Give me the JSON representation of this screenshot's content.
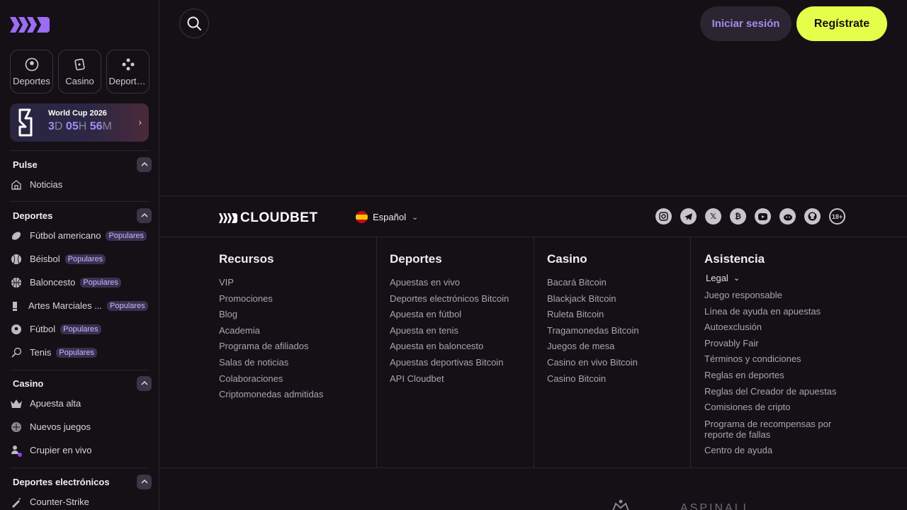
{
  "sidebar": {
    "quick_tiles": [
      {
        "label": "Deportes",
        "icon": "soccer-ball-icon"
      },
      {
        "label": "Casino",
        "icon": "cards-icon"
      },
      {
        "label": "Deportes electrónicos",
        "icon": "gamepad-icon"
      }
    ],
    "promo": {
      "title": "World Cup 2026",
      "days": "3",
      "days_unit": "D",
      "hours": "05",
      "hours_unit": "H",
      "minutes": "56",
      "minutes_unit": "M"
    },
    "sections": [
      {
        "title": "Pulse",
        "items": [
          {
            "label": "Noticias",
            "icon": "home-icon"
          }
        ]
      },
      {
        "title": "Deportes",
        "items": [
          {
            "label": "Fútbol americano",
            "badge": "Populares",
            "icon": "american-football-icon"
          },
          {
            "label": "Béisbol",
            "badge": "Populares",
            "icon": "baseball-icon"
          },
          {
            "label": "Baloncesto",
            "badge": "Populares",
            "icon": "basketball-icon"
          },
          {
            "label": "Artes Marciales ...",
            "badge": "Populares",
            "icon": "glove-icon"
          },
          {
            "label": "Fútbol",
            "badge": "Populares",
            "icon": "soccer-ball-icon"
          },
          {
            "label": "Tenis",
            "badge": "Populares",
            "icon": "tennis-racket-icon"
          }
        ]
      },
      {
        "title": "Casino",
        "items": [
          {
            "label": "Apuesta alta",
            "icon": "crown-icon"
          },
          {
            "label": "Nuevos juegos",
            "icon": "new-games-icon"
          },
          {
            "label": "Crupier en vivo",
            "icon": "dealer-icon"
          }
        ]
      },
      {
        "title": "Deportes electrónicos",
        "items": [
          {
            "label": "Counter-Strike",
            "icon": "rifle-icon"
          }
        ]
      }
    ]
  },
  "header": {
    "login_label": "Iniciar sesión",
    "register_label": "Regístrate"
  },
  "footer": {
    "brand": "CLOUDBET",
    "language": "Español",
    "socials": [
      "instagram",
      "telegram",
      "x",
      "bitcoin",
      "youtube",
      "reddit",
      "github",
      "18+"
    ],
    "age_label": "18+",
    "columns": [
      {
        "title": "Recursos",
        "links": [
          "VIP",
          "Promociones",
          "Blog",
          "Academia",
          "Programa de afiliados",
          "Salas de noticias",
          "Colaboraciones",
          "Criptomonedas admitidas"
        ]
      },
      {
        "title": "Deportes",
        "links": [
          "Apuestas en vivo",
          "Deportes electrónicos Bitcoin",
          "Apuesta en fútbol",
          "Apuesta en tenis",
          "Apuesta en baloncesto",
          "Apuestas deportivas Bitcoin",
          "API Cloudbet"
        ]
      },
      {
        "title": "Casino",
        "links": [
          "Bacará Bitcoin",
          "Blackjack Bitcoin",
          "Ruleta Bitcoin",
          "Tragamonedas Bitcoin",
          "Juegos de mesa",
          "Casino en vivo Bitcoin",
          "Casino Bitcoin"
        ]
      },
      {
        "title": "Asistencia",
        "legal_label": "Legal",
        "links": [
          "Juego responsable",
          "Línea de ayuda en apuestas",
          "Autoexclusión",
          "Provably Fair",
          "Términos y condiciones",
          "Reglas en deportes",
          "Reglas del Creador de apuestas",
          "Comisiones de cripto",
          "Programa de recompensas por reporte de fallas",
          "Centro de ayuda"
        ]
      }
    ],
    "partner": "ASPINALL"
  },
  "colors": {
    "accent": "#a58bf2",
    "cta": "#e3ff4a",
    "bg": "#141015",
    "badge_text": "#c9b7ff"
  }
}
